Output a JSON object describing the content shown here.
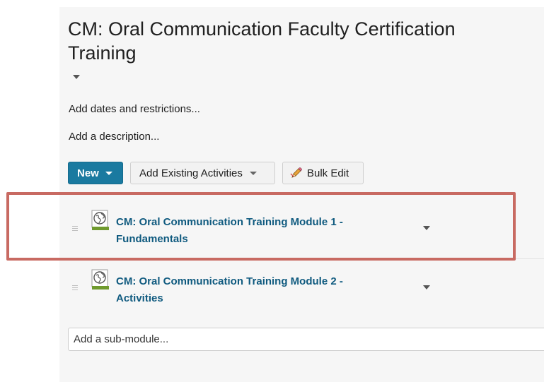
{
  "page": {
    "title": "CM: Oral Communication Faculty Certification Training",
    "add_dates": "Add dates and restrictions...",
    "add_description": "Add a description..."
  },
  "toolbar": {
    "new_label": "New",
    "add_existing_label": "Add Existing Activities",
    "bulk_edit_label": "Bulk Edit"
  },
  "modules": [
    {
      "title_line1": "CM: Oral Communication Training Module 1 -",
      "title_line2": "Fundamentals",
      "icon": "module-globe-icon"
    },
    {
      "title_line1": "CM: Oral Communication Training Module 2 -",
      "title_line2": "Activities",
      "icon": "module-globe-icon"
    }
  ],
  "submodule": {
    "placeholder": "Add a sub-module..."
  },
  "colors": {
    "primary_button": "#1a7aa0",
    "module_link": "#0f5a7f",
    "highlight_border": "#c86a62"
  }
}
